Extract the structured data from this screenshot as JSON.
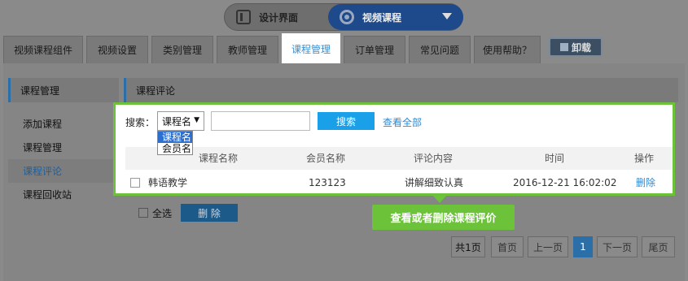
{
  "mode_switch": {
    "design_label": "设计界面",
    "course_label": "视频课程"
  },
  "tabs": [
    {
      "label": "视频课程组件"
    },
    {
      "label": "视频设置"
    },
    {
      "label": "类别管理"
    },
    {
      "label": "教师管理"
    },
    {
      "label": "课程管理"
    },
    {
      "label": "订单管理"
    },
    {
      "label": "常见问题"
    },
    {
      "label": "使用帮助？"
    }
  ],
  "unload_label": "卸载",
  "sidebar": {
    "title": "课程管理",
    "items": [
      {
        "label": "添加课程"
      },
      {
        "label": "课程管理"
      },
      {
        "label": "课程评论"
      },
      {
        "label": "课程回收站"
      }
    ]
  },
  "section_title": "课程评论",
  "search": {
    "label": "搜索：",
    "select_value": "课程名",
    "options": [
      "课程名",
      "会员名"
    ],
    "button": "搜索",
    "view_all": "查看全部"
  },
  "table": {
    "headers": [
      "课程名称",
      "会员名称",
      "评论内容",
      "时间",
      "操作"
    ],
    "rows": [
      {
        "course": "韩语教学",
        "member": "123123",
        "comment": "讲解细致认真",
        "time": "2016-12-21 16:02:02",
        "action": "删除"
      }
    ]
  },
  "bulk": {
    "select_all": "全选",
    "delete": "删 除"
  },
  "tooltip": "查看或者删除课程评价",
  "pagination": {
    "total": "共1页",
    "first": "首页",
    "prev": "上一页",
    "current": "1",
    "next": "下一页",
    "last": "尾页"
  },
  "colors": {
    "highlight": "#6cc33a",
    "primary": "#1aa0e8",
    "active_tab_text": "#3a8fd0"
  }
}
